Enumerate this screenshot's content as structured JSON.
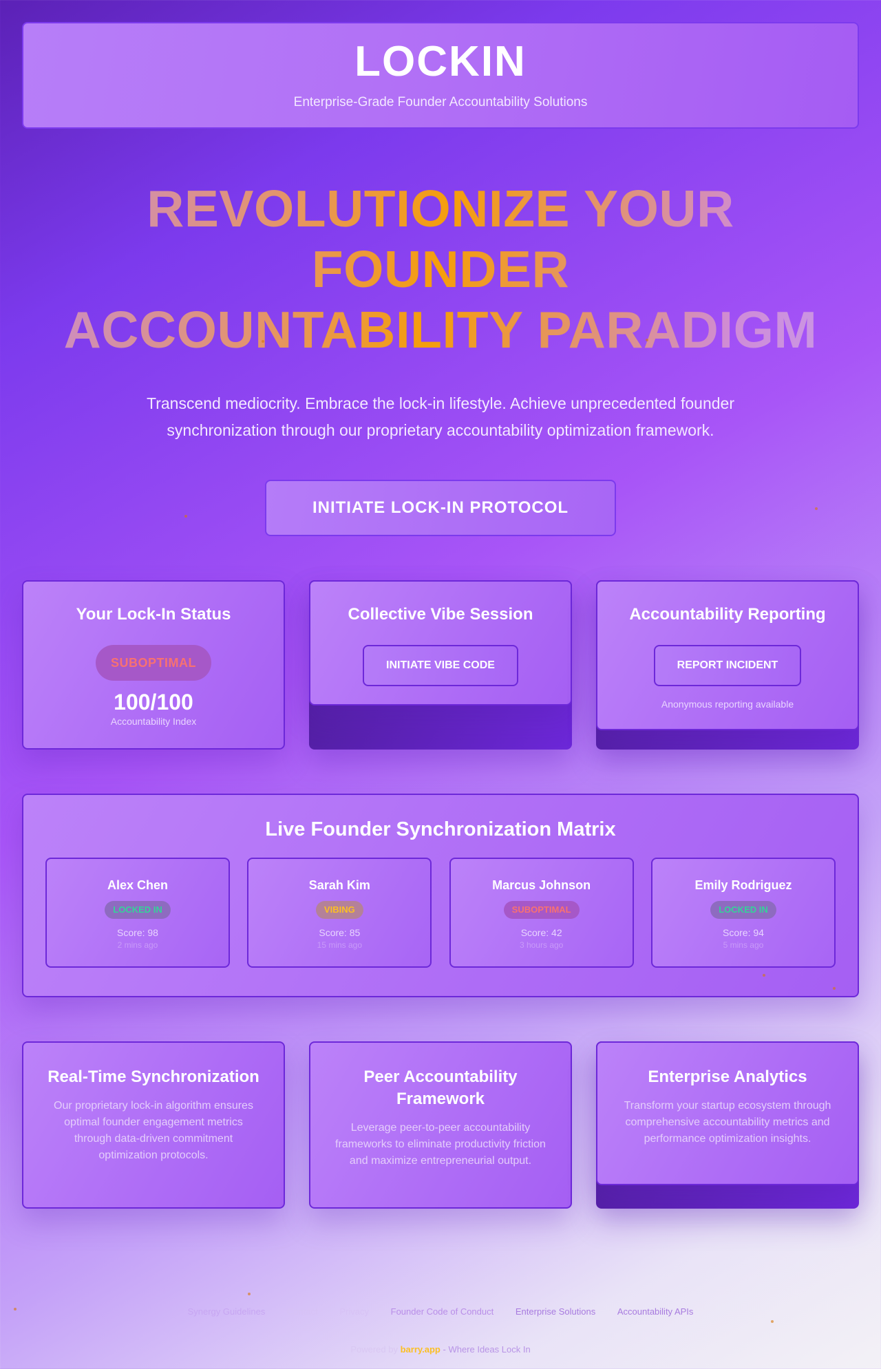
{
  "header": {
    "logo": "LOCKIN",
    "tagline": "Enterprise-Grade Founder Accountability Solutions"
  },
  "hero": {
    "title_line1": "REVOLUTIONIZE YOUR FOUNDER",
    "title_line2": "ACCOUNTABILITY PARADIGM",
    "subtitle": "Transcend mediocrity. Embrace the lock-in lifestyle. Achieve unprecedented founder synchronization through our proprietary accountability optimization framework.",
    "cta_label": "INITIATE LOCK-IN PROTOCOL"
  },
  "status_card": {
    "title": "Your Lock-In Status",
    "badge": "SUBOPTIMAL",
    "score": "100/100",
    "score_label": "Accountability Index"
  },
  "vibe_card": {
    "title": "Collective Vibe Session",
    "button": "INITIATE VIBE CODE"
  },
  "report_card": {
    "title": "Accountability Reporting",
    "button": "REPORT INCIDENT",
    "note": "Anonymous reporting available"
  },
  "matrix": {
    "title": "Live Founder Synchronization Matrix",
    "founders": [
      {
        "name": "Alex Chen",
        "status": "LOCKED IN",
        "score": "Score: 98",
        "time": "2 mins ago"
      },
      {
        "name": "Sarah Kim",
        "status": "VIBING",
        "score": "Score: 85",
        "time": "15 mins ago"
      },
      {
        "name": "Marcus Johnson",
        "status": "SUBOPTIMAL",
        "score": "Score: 42",
        "time": "3 hours ago"
      },
      {
        "name": "Emily Rodriguez",
        "status": "LOCKED IN",
        "score": "Score: 94",
        "time": "5 mins ago"
      }
    ]
  },
  "features": [
    {
      "title": "Real-Time Synchronization",
      "text": "Our proprietary lock-in algorithm ensures optimal founder engagement metrics through data-driven commitment optimization protocols."
    },
    {
      "title": "Peer Accountability Framework",
      "text": "Leverage peer-to-peer accountability frameworks to eliminate productivity friction and maximize entrepreneurial output."
    },
    {
      "title": "Enterprise Analytics",
      "text": "Transform your startup ecosystem through comprehensive accountability metrics and performance optimization insights."
    }
  ],
  "footer": {
    "links": [
      "Synergy Guidelines",
      "Contact",
      "Privacy",
      "Founder Code of Conduct",
      "Enterprise Solutions",
      "Accountability APIs"
    ],
    "powered_prefix": "Powered by",
    "powered_brand": "barry.app",
    "powered_suffix": "- Where Ideas Lock In"
  },
  "colors": {
    "accent": "#a855f7",
    "border": "#6d28d9",
    "locked": "#34d399",
    "vibing": "#fbbf24",
    "suboptimal": "#f87171",
    "hero_gradient_mid": "#f59e0b"
  }
}
